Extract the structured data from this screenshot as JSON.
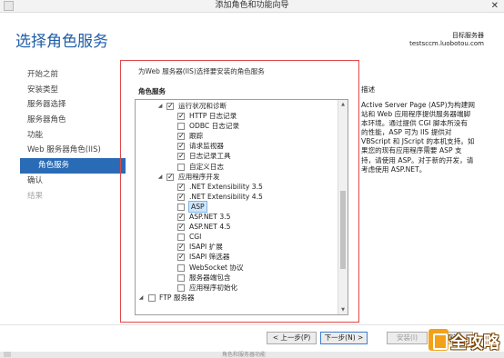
{
  "window": {
    "title": "添加角色和功能向导",
    "close_glyph": "✕"
  },
  "header": {
    "title": "选择角色服务",
    "server_label": "目标服务器",
    "server_name": "testsccm.luobotou.com"
  },
  "nav": [
    {
      "label": "开始之前",
      "state": "normal"
    },
    {
      "label": "安装类型",
      "state": "normal"
    },
    {
      "label": "服务器选择",
      "state": "normal"
    },
    {
      "label": "服务器角色",
      "state": "normal"
    },
    {
      "label": "功能",
      "state": "normal"
    },
    {
      "label": "Web 服务器角色(IIS)",
      "state": "normal"
    },
    {
      "label": "角色服务",
      "state": "active"
    },
    {
      "label": "确认",
      "state": "normal"
    },
    {
      "label": "结果",
      "state": "disabled"
    }
  ],
  "content": {
    "intro": "为Web 服务器(IIS)选择要安装的角色服务",
    "roles_header": "角色服务",
    "tree": [
      {
        "label": "运行状况和诊断",
        "level": 1,
        "expander": "◢",
        "check": "checked"
      },
      {
        "label": "HTTP 日志记录",
        "level": 2,
        "check": "checked"
      },
      {
        "label": "ODBC 日志记录",
        "level": 2,
        "check": "unchecked"
      },
      {
        "label": "跟踪",
        "level": 2,
        "check": "checked"
      },
      {
        "label": "请求监视器",
        "level": 2,
        "check": "checked"
      },
      {
        "label": "日志记录工具",
        "level": 2,
        "check": "checked"
      },
      {
        "label": "自定义日志",
        "level": 2,
        "check": "unchecked"
      },
      {
        "label": "应用程序开发",
        "level": 1,
        "expander": "◢",
        "check": "checked"
      },
      {
        "label": ".NET Extensibility 3.5",
        "level": 2,
        "check": "checked"
      },
      {
        "label": ".NET Extensibility 4.5",
        "level": 2,
        "check": "checked"
      },
      {
        "label": "ASP",
        "level": 2,
        "check": "unchecked",
        "selected": true
      },
      {
        "label": "ASP.NET 3.5",
        "level": 2,
        "check": "checked"
      },
      {
        "label": "ASP.NET 4.5",
        "level": 2,
        "check": "checked"
      },
      {
        "label": "CGI",
        "level": 2,
        "check": "unchecked"
      },
      {
        "label": "ISAPI 扩展",
        "level": 2,
        "check": "checked"
      },
      {
        "label": "ISAPI 筛选器",
        "level": 2,
        "check": "checked"
      },
      {
        "label": "WebSocket 协议",
        "level": 2,
        "check": "unchecked"
      },
      {
        "label": "服务器端包含",
        "level": 2,
        "check": "unchecked"
      },
      {
        "label": "应用程序初始化",
        "level": 2,
        "check": "unchecked"
      },
      {
        "label": "FTP 服务器",
        "level": 0,
        "expander": "◢",
        "check": "unchecked"
      }
    ],
    "scroll_up_glyph": "▲",
    "scroll_down_glyph": "▼"
  },
  "description": {
    "title": "描述",
    "lines": [
      "Active Server Page (ASP)为构建网",
      "站和 Web 应用程序提供服务器端脚",
      "本环境。通过提供 CGI 脚本所没有",
      "的性能，ASP 可为 IIS 提供对",
      "VBScript 和 JScript 的本机支持。如",
      "果您的现有应用程序需要 ASP 支",
      "持，请使用 ASP。对于新的开发，请",
      "考虑使用 ASP.NET。"
    ]
  },
  "buttons": {
    "prev": "< 上一步(P)",
    "next": "下一步(N) >",
    "install": "安装(I)",
    "cancel": "取消"
  },
  "footer": {
    "partial_text": "角色和服务器功能"
  },
  "watermark": {
    "text": "全攻略"
  }
}
